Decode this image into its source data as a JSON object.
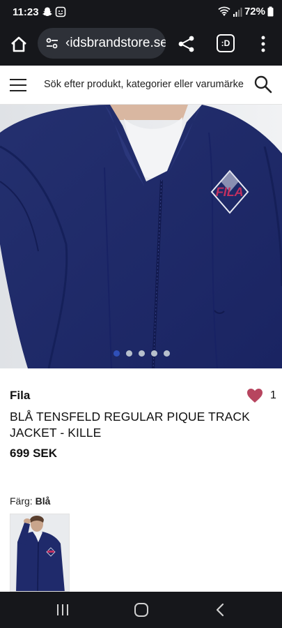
{
  "status_bar": {
    "time": "11:23",
    "battery": "72%"
  },
  "browser": {
    "url": "‹idsbrandstore.se",
    "tabs_label": ":D"
  },
  "header": {
    "search_placeholder": "Sök efter produkt, kategorier eller varumärke"
  },
  "carousel": {
    "total": 5,
    "active_index": 0
  },
  "product": {
    "brand": "Fila",
    "favorites_count": "1",
    "title": "BLÅ TENSFELD REGULAR PIQUE TRACK JACKET - KILLE",
    "price": "699 SEK",
    "color_label": "Färg:",
    "color_value": "Blå"
  },
  "colors": {
    "chrome_bg": "#16171b",
    "url_pill": "#2e3138",
    "jacket_navy": "#1f2a6b",
    "heart": "#b7455f",
    "dot_active": "#2f4fb8",
    "dot_inactive": "#b7c0cc"
  },
  "icons": {
    "status": [
      "snapchat-icon",
      "screenshot-icon",
      "wifi-icon",
      "signal-icon",
      "battery-icon"
    ],
    "browser": [
      "home-icon",
      "tune-icon",
      "share-icon",
      "tabs-icon",
      "more-vert-icon"
    ],
    "site": [
      "hamburger-icon",
      "search-icon",
      "heart-icon"
    ],
    "nav": [
      "recents-icon",
      "home-circle-icon",
      "back-icon"
    ]
  }
}
